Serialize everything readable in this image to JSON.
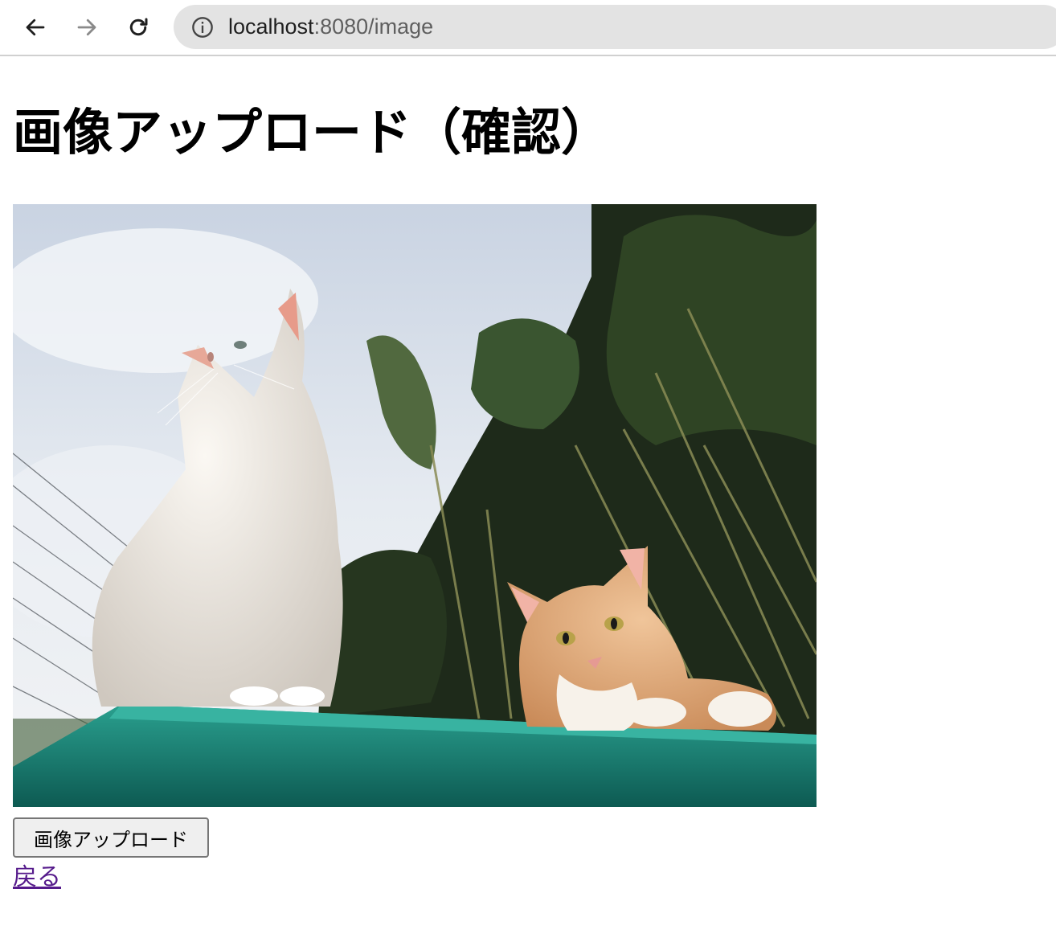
{
  "browser": {
    "url_host": "localhost",
    "url_rest": ":8080/image",
    "icons": {
      "back": "arrow-left-icon",
      "forward": "arrow-right-icon",
      "reload": "reload-icon",
      "site_info": "info-icon"
    }
  },
  "page": {
    "title": "画像アップロード（確認）",
    "upload_button_label": "画像アップロード",
    "back_link_label": "戻る"
  },
  "colors": {
    "link_visited": "#551a8b",
    "omnibox_bg": "#e3e3e3"
  }
}
